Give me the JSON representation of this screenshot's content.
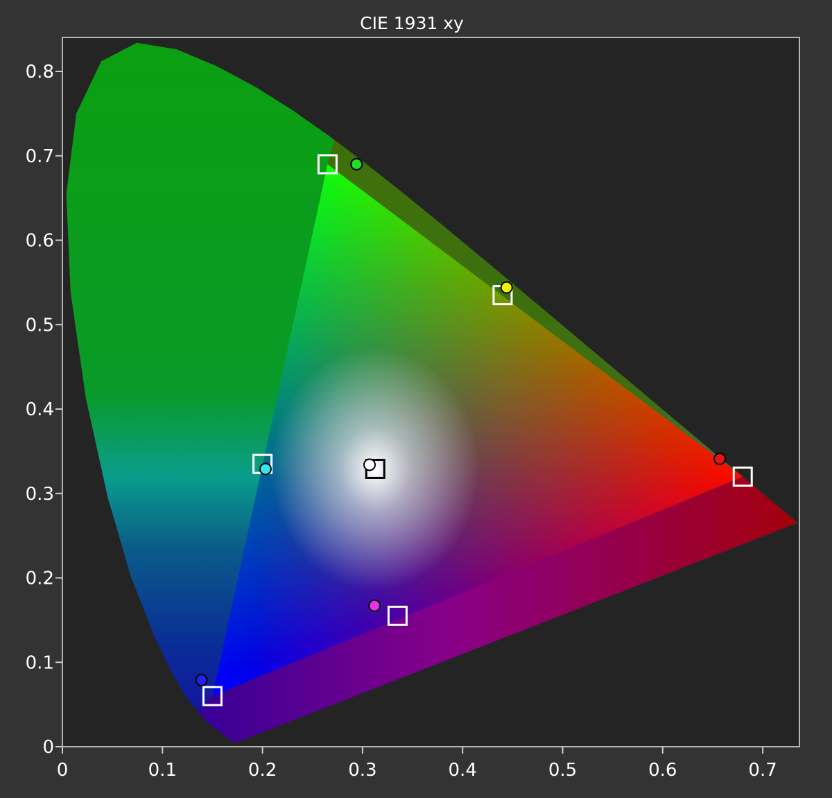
{
  "chart_data": {
    "type": "scatter",
    "title": "CIE 1931 xy",
    "xlabel": "",
    "ylabel": "",
    "xlim": [
      0,
      0.735
    ],
    "ylim": [
      0,
      0.84
    ],
    "x_ticks": [
      "0",
      "0.1",
      "0.2",
      "0.3",
      "0.4",
      "0.5",
      "0.6",
      "0.7"
    ],
    "y_ticks": [
      "0",
      "0.1",
      "0.2",
      "0.3",
      "0.4",
      "0.5",
      "0.6",
      "0.7",
      "0.8"
    ],
    "grid": false,
    "target_gamut": [
      [
        0.68,
        0.32
      ],
      [
        0.265,
        0.69
      ],
      [
        0.15,
        0.06
      ]
    ],
    "targets": [
      {
        "color": "green",
        "x": 0.265,
        "y": 0.69
      },
      {
        "color": "yellow",
        "x": 0.44,
        "y": 0.535
      },
      {
        "color": "cyan",
        "x": 0.2,
        "y": 0.335
      },
      {
        "color": "white",
        "x": 0.3127,
        "y": 0.329
      },
      {
        "color": "red",
        "x": 0.68,
        "y": 0.32
      },
      {
        "color": "magenta",
        "x": 0.335,
        "y": 0.155
      },
      {
        "color": "blue",
        "x": 0.15,
        "y": 0.06
      }
    ],
    "measured": [
      {
        "color": "green",
        "x": 0.294,
        "y": 0.69,
        "fill": "#22dd22"
      },
      {
        "color": "yellow",
        "x": 0.444,
        "y": 0.544,
        "fill": "#f2f200"
      },
      {
        "color": "cyan",
        "x": 0.203,
        "y": 0.329,
        "fill": "#33e6ee"
      },
      {
        "color": "white",
        "x": 0.307,
        "y": 0.334,
        "fill": "#ffffff"
      },
      {
        "color": "red",
        "x": 0.657,
        "y": 0.341,
        "fill": "#ee1111"
      },
      {
        "color": "magenta",
        "x": 0.312,
        "y": 0.167,
        "fill": "#e833e8"
      },
      {
        "color": "blue",
        "x": 0.139,
        "y": 0.079,
        "fill": "#2222ee"
      }
    ]
  }
}
